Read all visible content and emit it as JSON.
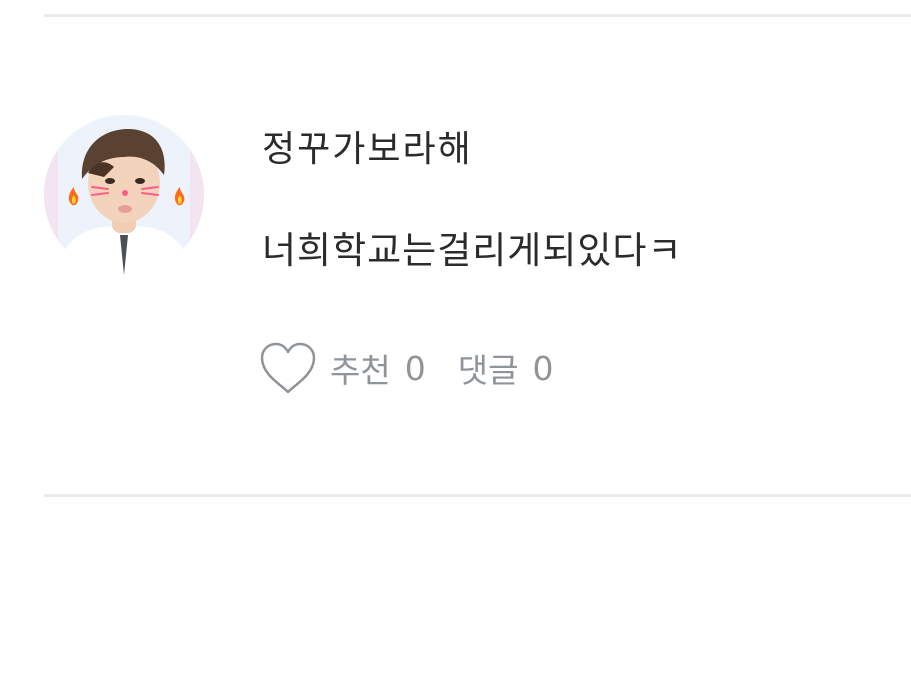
{
  "comment": {
    "author": "정꾸가보라해",
    "text": "너희학교는걸리게되있다ㅋ",
    "actions": {
      "like_label": "추천",
      "like_count": "0",
      "reply_label": "댓글",
      "reply_count": "0"
    }
  },
  "icons": {
    "like": "heart-outline-icon"
  },
  "colors": {
    "text": "#2b2b2b",
    "muted": "#8f9499",
    "divider": "#ebebeb"
  }
}
